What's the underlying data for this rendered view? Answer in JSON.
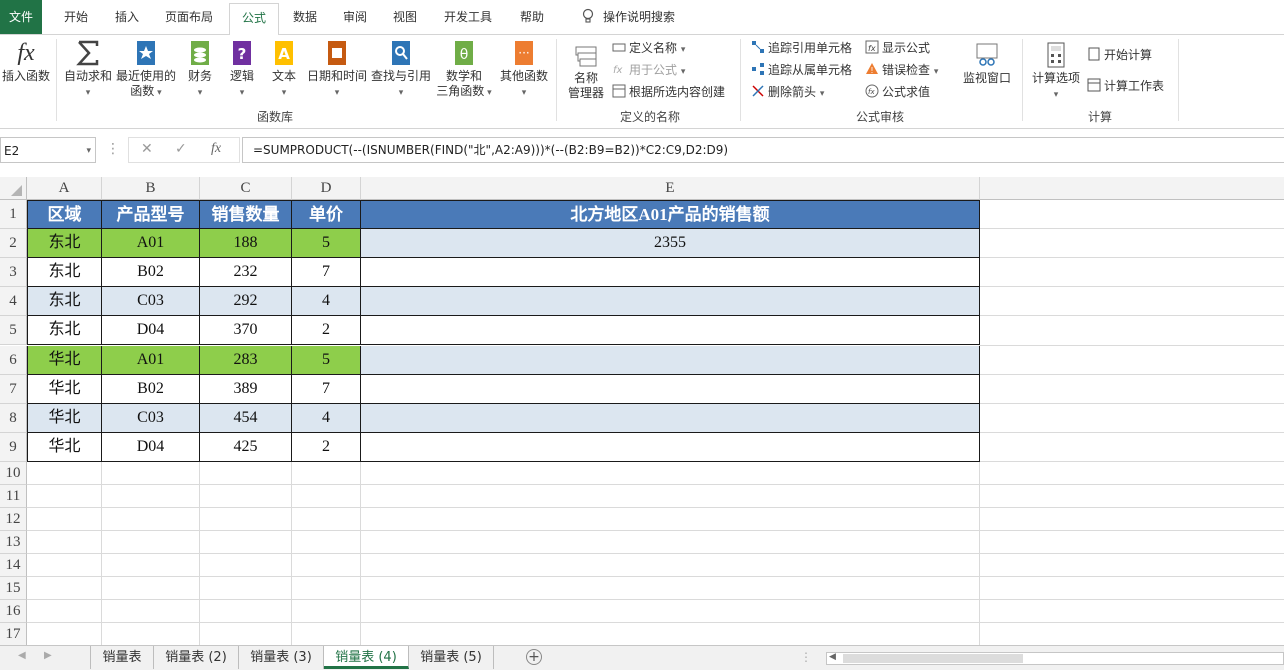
{
  "menu": {
    "file": "文件",
    "tabs": [
      "开始",
      "插入",
      "页面布局",
      "公式",
      "数据",
      "审阅",
      "视图",
      "开发工具",
      "帮助"
    ],
    "active_tab": "公式",
    "tell_me": "操作说明搜索"
  },
  "ribbon": {
    "insert_function": "插入函数",
    "autosum": "自动求和",
    "recent": "最近使用的",
    "recent2": "函数",
    "financial": "财务",
    "logical": "逻辑",
    "text": "文本",
    "datetime": "日期和时间",
    "lookup": "查找与引用",
    "math": "数学和",
    "math2": "三角函数",
    "more": "其他函数",
    "group_library": "函数库",
    "name_manager": "名称",
    "name_manager2": "管理器",
    "define_name": "定义名称",
    "use_in_formula": "用于公式",
    "create_from_selection": "根据所选内容创建",
    "group_names": "定义的名称",
    "trace_precedents": "追踪引用单元格",
    "trace_dependents": "追踪从属单元格",
    "remove_arrows": "删除箭头",
    "show_formulas": "显示公式",
    "error_checking": "错误检查",
    "evaluate_formula": "公式求值",
    "watch_window": "监视窗口",
    "group_auditing": "公式审核",
    "calc_options": "计算选项",
    "calc_now": "开始计算",
    "calc_sheet": "计算工作表",
    "group_calc": "计算",
    "icon_fx": "fx"
  },
  "formula_bar": {
    "name_box": "E2",
    "formula": "=SUMPRODUCT(--(ISNUMBER(FIND(\"北\",A2:A9)))*(--(B2:B9=B2))*C2:C9,D2:D9)",
    "fx_label": "fx"
  },
  "columns": [
    "A",
    "B",
    "C",
    "D",
    "E"
  ],
  "row_numbers": [
    "1",
    "2",
    "3",
    "4",
    "5",
    "6",
    "7",
    "8",
    "9",
    "10",
    "11",
    "12",
    "13",
    "14",
    "15",
    "16",
    "17"
  ],
  "table": {
    "headers": [
      "区域",
      "产品型号",
      "销售数量",
      "单价",
      "北方地区A01产品的销售额"
    ],
    "rows": [
      [
        "东北",
        "A01",
        "188",
        "5",
        "2355"
      ],
      [
        "东北",
        "B02",
        "232",
        "7",
        ""
      ],
      [
        "东北",
        "C03",
        "292",
        "4",
        ""
      ],
      [
        "东北",
        "D04",
        "370",
        "2",
        ""
      ],
      [
        "华北",
        "A01",
        "283",
        "5",
        ""
      ],
      [
        "华北",
        "B02",
        "389",
        "7",
        ""
      ],
      [
        "华北",
        "C03",
        "454",
        "4",
        ""
      ],
      [
        "华北",
        "D04",
        "425",
        "2",
        ""
      ]
    ]
  },
  "colors": {
    "header_blue": "#4a7ab8",
    "highlight_green": "#8ece4b",
    "band_blue": "#dce6f0",
    "excel_green": "#217346"
  },
  "sheets": [
    "销量表",
    "销量表 (2)",
    "销量表 (3)",
    "销量表 (4)",
    "销量表 (5)"
  ],
  "active_sheet": "销量表 (4)"
}
